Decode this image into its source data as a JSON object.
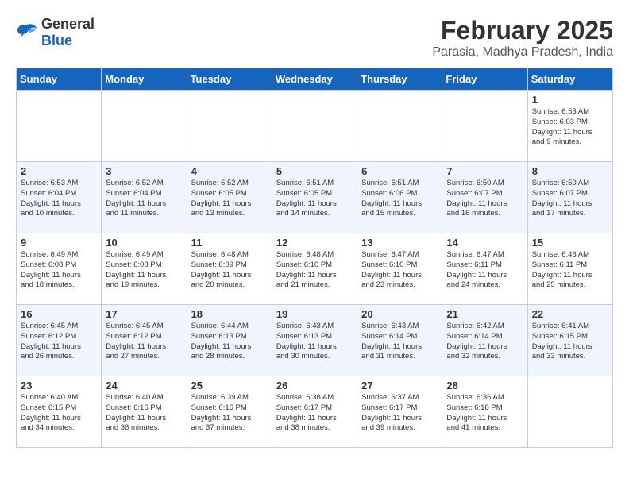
{
  "header": {
    "logo_general": "General",
    "logo_blue": "Blue",
    "title": "February 2025",
    "subtitle": "Parasia, Madhya Pradesh, India"
  },
  "days_of_week": [
    "Sunday",
    "Monday",
    "Tuesday",
    "Wednesday",
    "Thursday",
    "Friday",
    "Saturday"
  ],
  "weeks": [
    [
      {
        "day": "",
        "info": ""
      },
      {
        "day": "",
        "info": ""
      },
      {
        "day": "",
        "info": ""
      },
      {
        "day": "",
        "info": ""
      },
      {
        "day": "",
        "info": ""
      },
      {
        "day": "",
        "info": ""
      },
      {
        "day": "1",
        "info": "Sunrise: 6:53 AM\nSunset: 6:03 PM\nDaylight: 11 hours\nand 9 minutes."
      }
    ],
    [
      {
        "day": "2",
        "info": "Sunrise: 6:53 AM\nSunset: 6:04 PM\nDaylight: 11 hours\nand 10 minutes."
      },
      {
        "day": "3",
        "info": "Sunrise: 6:52 AM\nSunset: 6:04 PM\nDaylight: 11 hours\nand 11 minutes."
      },
      {
        "day": "4",
        "info": "Sunrise: 6:52 AM\nSunset: 6:05 PM\nDaylight: 11 hours\nand 13 minutes."
      },
      {
        "day": "5",
        "info": "Sunrise: 6:51 AM\nSunset: 6:05 PM\nDaylight: 11 hours\nand 14 minutes."
      },
      {
        "day": "6",
        "info": "Sunrise: 6:51 AM\nSunset: 6:06 PM\nDaylight: 11 hours\nand 15 minutes."
      },
      {
        "day": "7",
        "info": "Sunrise: 6:50 AM\nSunset: 6:07 PM\nDaylight: 11 hours\nand 16 minutes."
      },
      {
        "day": "8",
        "info": "Sunrise: 6:50 AM\nSunset: 6:07 PM\nDaylight: 11 hours\nand 17 minutes."
      }
    ],
    [
      {
        "day": "9",
        "info": "Sunrise: 6:49 AM\nSunset: 6:08 PM\nDaylight: 11 hours\nand 18 minutes."
      },
      {
        "day": "10",
        "info": "Sunrise: 6:49 AM\nSunset: 6:08 PM\nDaylight: 11 hours\nand 19 minutes."
      },
      {
        "day": "11",
        "info": "Sunrise: 6:48 AM\nSunset: 6:09 PM\nDaylight: 11 hours\nand 20 minutes."
      },
      {
        "day": "12",
        "info": "Sunrise: 6:48 AM\nSunset: 6:10 PM\nDaylight: 11 hours\nand 21 minutes."
      },
      {
        "day": "13",
        "info": "Sunrise: 6:47 AM\nSunset: 6:10 PM\nDaylight: 11 hours\nand 23 minutes."
      },
      {
        "day": "14",
        "info": "Sunrise: 6:47 AM\nSunset: 6:11 PM\nDaylight: 11 hours\nand 24 minutes."
      },
      {
        "day": "15",
        "info": "Sunrise: 6:46 AM\nSunset: 6:11 PM\nDaylight: 11 hours\nand 25 minutes."
      }
    ],
    [
      {
        "day": "16",
        "info": "Sunrise: 6:45 AM\nSunset: 6:12 PM\nDaylight: 11 hours\nand 26 minutes."
      },
      {
        "day": "17",
        "info": "Sunrise: 6:45 AM\nSunset: 6:12 PM\nDaylight: 11 hours\nand 27 minutes."
      },
      {
        "day": "18",
        "info": "Sunrise: 6:44 AM\nSunset: 6:13 PM\nDaylight: 11 hours\nand 28 minutes."
      },
      {
        "day": "19",
        "info": "Sunrise: 6:43 AM\nSunset: 6:13 PM\nDaylight: 11 hours\nand 30 minutes."
      },
      {
        "day": "20",
        "info": "Sunrise: 6:43 AM\nSunset: 6:14 PM\nDaylight: 11 hours\nand 31 minutes."
      },
      {
        "day": "21",
        "info": "Sunrise: 6:42 AM\nSunset: 6:14 PM\nDaylight: 11 hours\nand 32 minutes."
      },
      {
        "day": "22",
        "info": "Sunrise: 6:41 AM\nSunset: 6:15 PM\nDaylight: 11 hours\nand 33 minutes."
      }
    ],
    [
      {
        "day": "23",
        "info": "Sunrise: 6:40 AM\nSunset: 6:15 PM\nDaylight: 11 hours\nand 34 minutes."
      },
      {
        "day": "24",
        "info": "Sunrise: 6:40 AM\nSunset: 6:16 PM\nDaylight: 11 hours\nand 36 minutes."
      },
      {
        "day": "25",
        "info": "Sunrise: 6:39 AM\nSunset: 6:16 PM\nDaylight: 11 hours\nand 37 minutes."
      },
      {
        "day": "26",
        "info": "Sunrise: 6:38 AM\nSunset: 6:17 PM\nDaylight: 11 hours\nand 38 minutes."
      },
      {
        "day": "27",
        "info": "Sunrise: 6:37 AM\nSunset: 6:17 PM\nDaylight: 11 hours\nand 39 minutes."
      },
      {
        "day": "28",
        "info": "Sunrise: 6:36 AM\nSunset: 6:18 PM\nDaylight: 11 hours\nand 41 minutes."
      },
      {
        "day": "",
        "info": ""
      }
    ]
  ]
}
